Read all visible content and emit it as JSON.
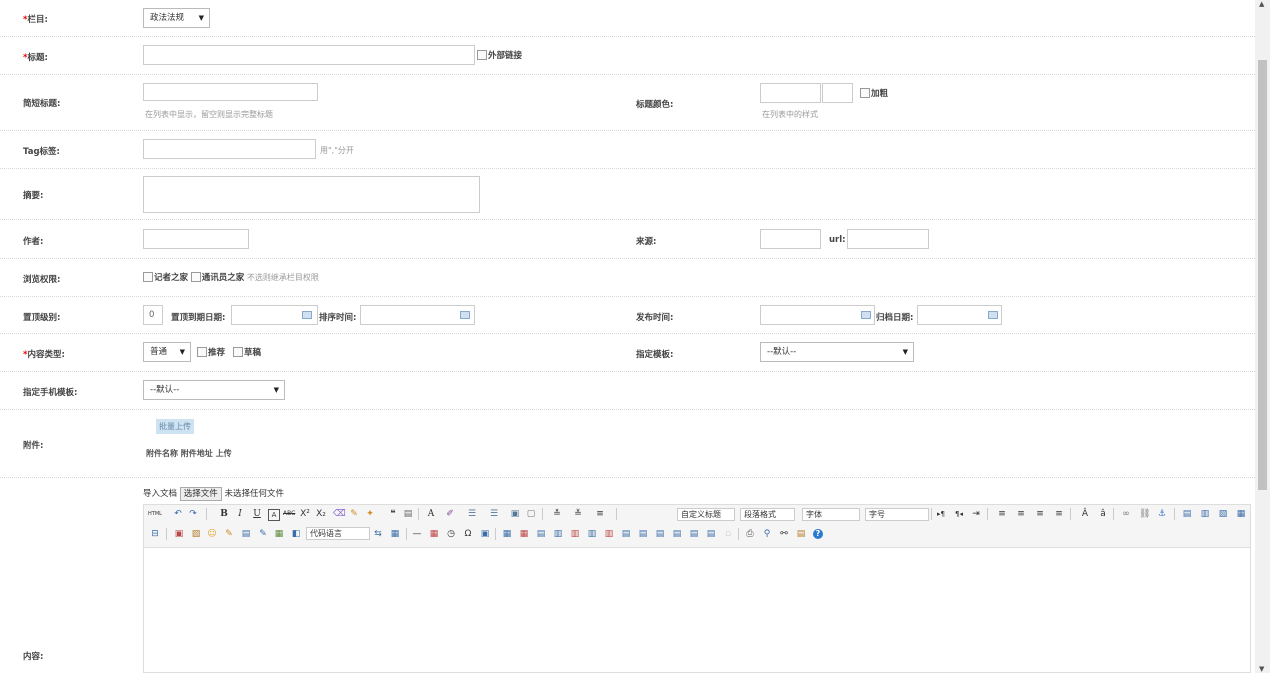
{
  "column": {
    "label": "栏目:",
    "value": "政法法规"
  },
  "title": {
    "label": "标题:",
    "external_link": "外部链接"
  },
  "short_title": {
    "label": "简短标题:",
    "hint": "在列表中显示，留空则显示完整标题"
  },
  "title_color": {
    "label": "标题颜色:",
    "bold": "加粗",
    "hint": "在列表中的样式"
  },
  "tag": {
    "label": "Tag标签:",
    "hint": "用\",\"分开"
  },
  "summary": {
    "label": "摘要:"
  },
  "author": {
    "label": "作者:"
  },
  "source": {
    "label": "来源:",
    "url_label": "url:"
  },
  "permission": {
    "label": "浏览权限:",
    "opt1": "记者之家",
    "opt2": "通讯员之家",
    "hint": "不选则继承栏目权限"
  },
  "pin": {
    "label": "置顶级别:",
    "value": "0",
    "expire_label": "置顶到期日期:",
    "sort_label": "排序时间:"
  },
  "publish": {
    "label": "发布时间:",
    "archive_label": "归档日期:"
  },
  "content_type": {
    "label": "内容类型:",
    "value": "普通",
    "recommend": "推荐",
    "draft": "草稿"
  },
  "template": {
    "label": "指定模板:",
    "value": "--默认--"
  },
  "mobile_template": {
    "label": "指定手机模板:",
    "value": "--默认--"
  },
  "attachment": {
    "label": "附件:",
    "batch_upload": "批量上传",
    "columns": "附件名称 附件地址 上传"
  },
  "import_doc": {
    "label": "导入文档",
    "button": "选择文件",
    "status": "未选择任何文件"
  },
  "editor": {
    "custom_title": "自定义标题",
    "paragraph": "段落格式",
    "font": "字体",
    "font_size": "字号",
    "code_lang": "代码语言",
    "html_label": "HTML"
  },
  "content": {
    "label": "内容:"
  },
  "colors": {
    "required": "#ee0000",
    "batch_bg": "#cde3f2"
  }
}
